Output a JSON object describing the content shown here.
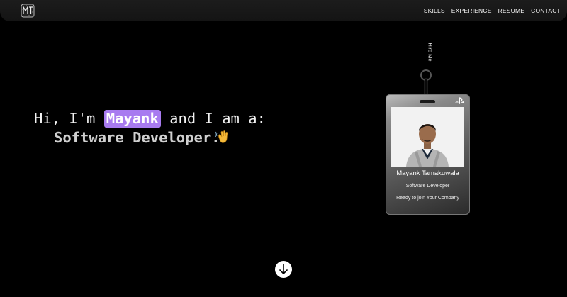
{
  "nav": {
    "logo_icon": "monogram-logo-icon",
    "links": [
      "SKILLS",
      "EXPERIENCE",
      "RESUME",
      "CONTACT"
    ]
  },
  "hero": {
    "greeting_prefix": "Hi, I'm",
    "name": "Mayank",
    "greeting_suffix": "and I am a:",
    "role": "Software Developer.",
    "emoji_icon": "waving-hand-icon"
  },
  "lanyard": {
    "strap_label": "Hire Me!",
    "badge": {
      "logo_icon": "playstation-logo-icon",
      "name": "Mayank Tamakuwala",
      "title": "Software Developer",
      "tagline": "Ready to join Your Company"
    }
  },
  "scroll": {
    "icon": "arrow-down-icon"
  },
  "colors": {
    "highlight": "#a87bf0",
    "background": "#000000"
  }
}
